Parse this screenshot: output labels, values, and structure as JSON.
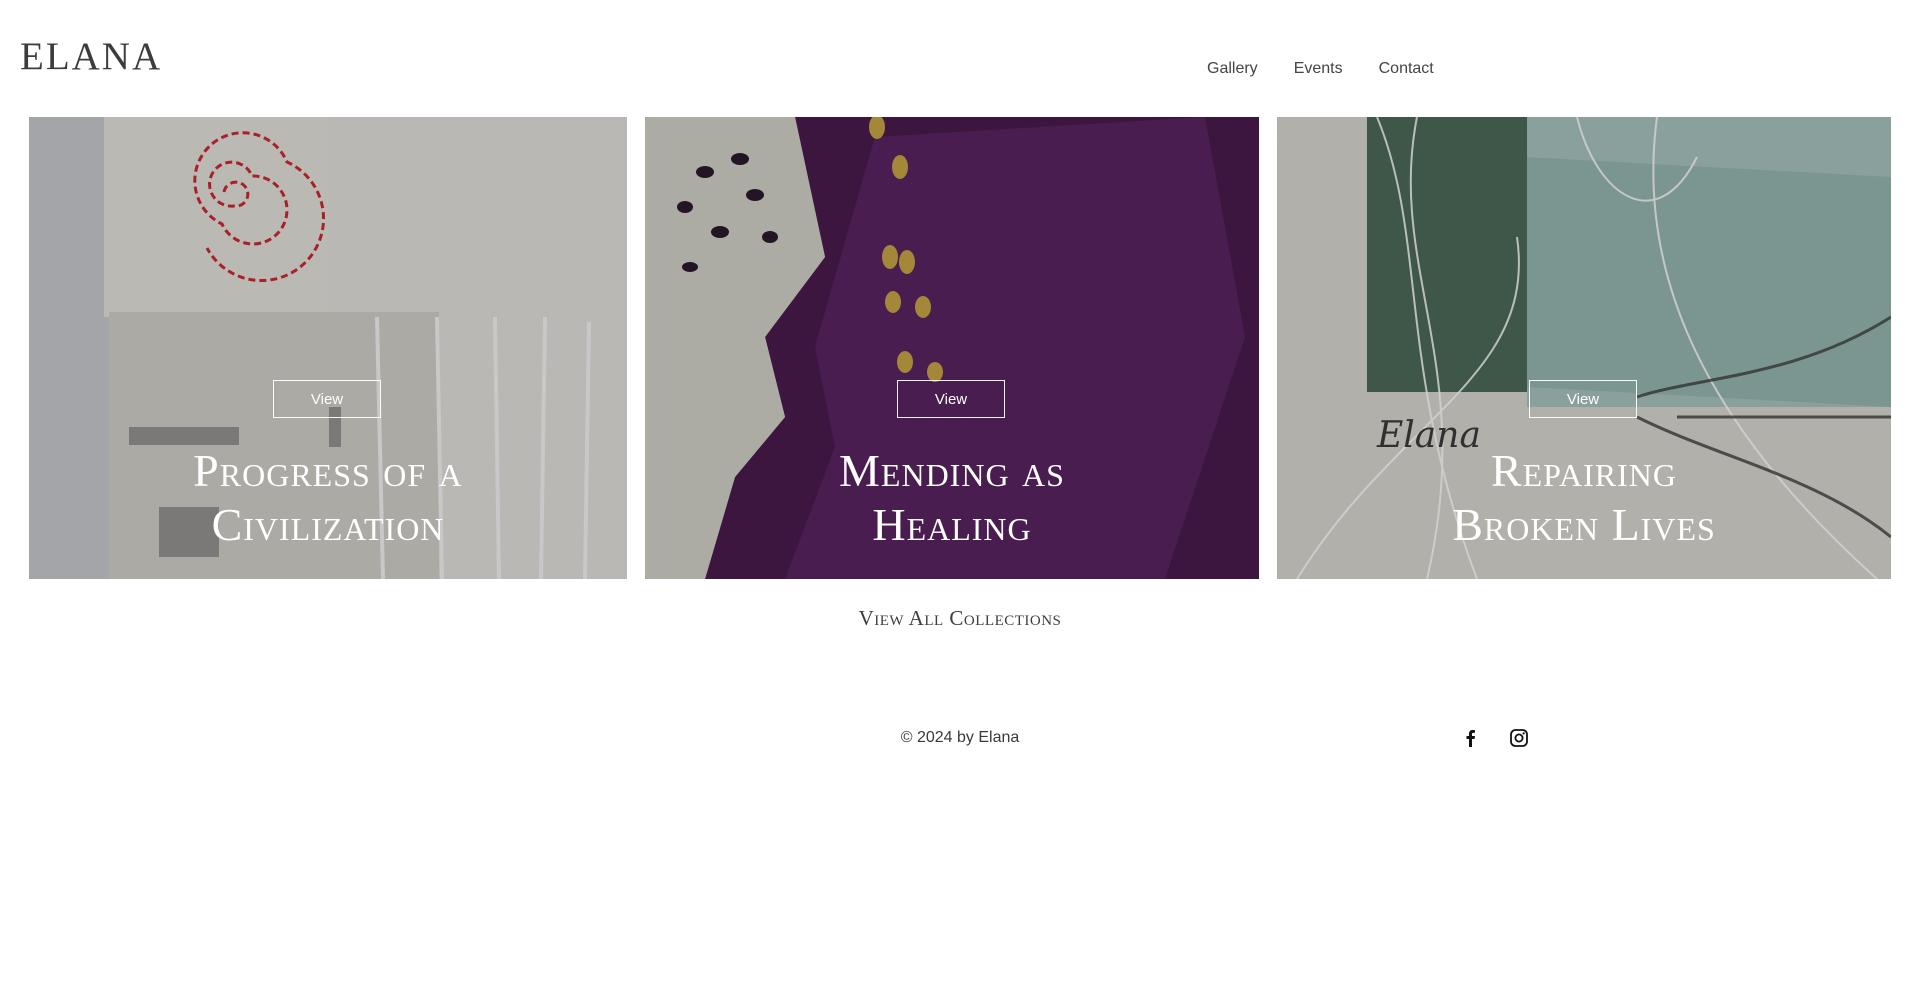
{
  "header": {
    "logo": "ELANA",
    "nav": [
      "Gallery",
      "Events",
      "Contact"
    ]
  },
  "collections": [
    {
      "title_line1": "Progress of a",
      "title_line2": "Civilization",
      "button": "View"
    },
    {
      "title_line1": "Mending as",
      "title_line2": "Healing",
      "button": "View"
    },
    {
      "title_line1": "Repairing",
      "title_line2": "Broken Lives",
      "button": "View"
    }
  ],
  "view_all": "View All Collections",
  "footer": {
    "copyright": "© 2024 by Elana",
    "social_icons": [
      "facebook-icon",
      "instagram-icon"
    ]
  }
}
